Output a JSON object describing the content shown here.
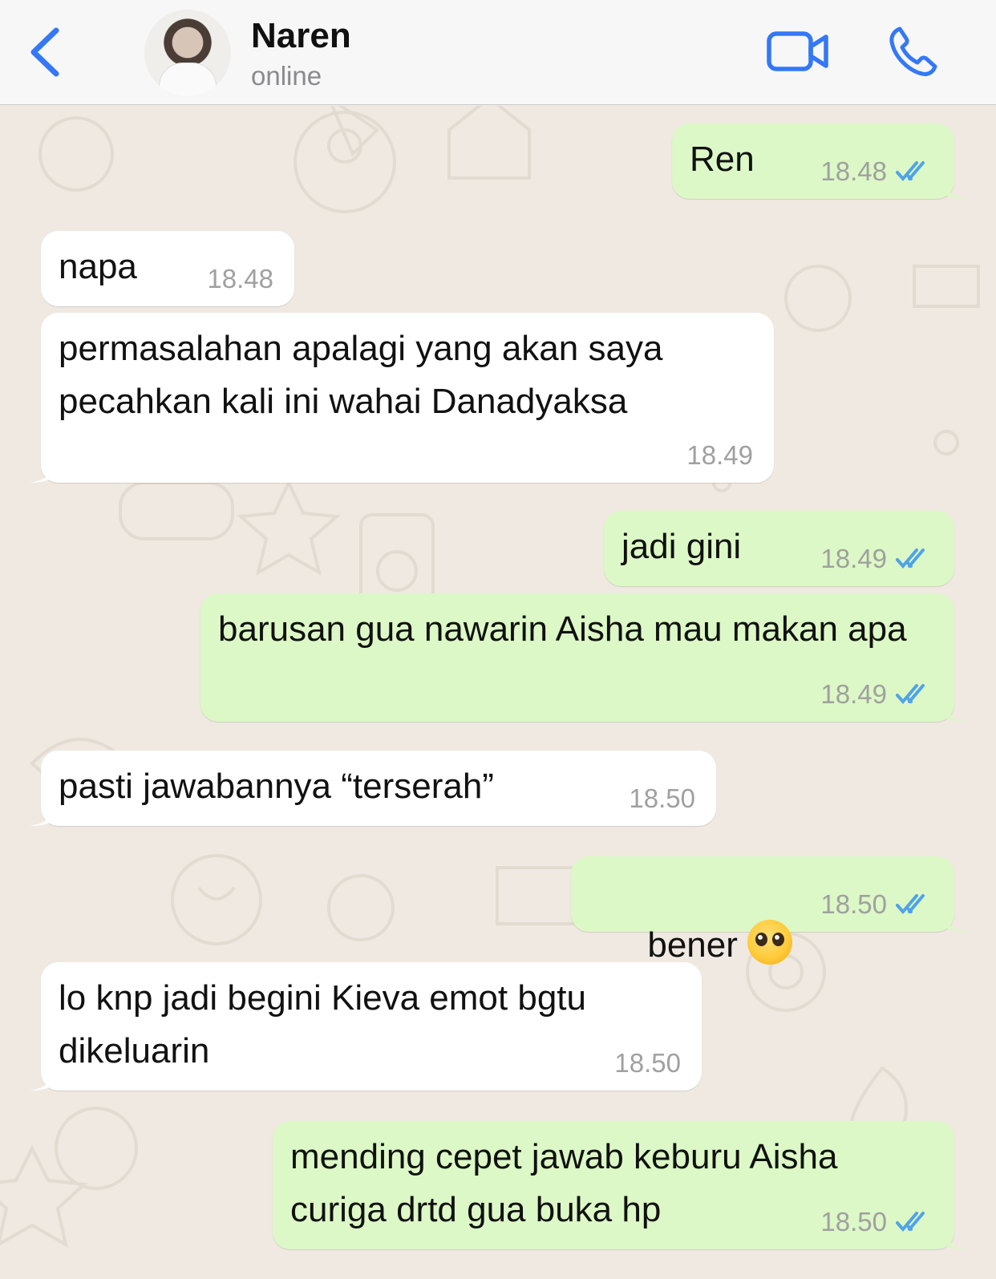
{
  "header": {
    "contact_name": "Naren",
    "contact_status": "online",
    "back_icon": "chevron-left-icon",
    "video_icon": "video-camera-icon",
    "call_icon": "phone-icon",
    "accent_color": "#3478f6"
  },
  "messages": [
    {
      "direction": "out",
      "text": "Ren",
      "time": "18.48",
      "status": "read"
    },
    {
      "direction": "in",
      "text": "napa",
      "time": "18.48"
    },
    {
      "direction": "in",
      "text": "permasalahan apalagi yang akan saya pecahkan kali ini wahai Danadyaksa",
      "time": "18.49"
    },
    {
      "direction": "out",
      "text": "jadi gini",
      "time": "18.49",
      "status": "read"
    },
    {
      "direction": "out",
      "text": "barusan gua nawarin Aisha mau makan apa",
      "time": "18.49",
      "status": "read"
    },
    {
      "direction": "in",
      "text": "pasti jawabannya “terserah”",
      "time": "18.50"
    },
    {
      "direction": "out",
      "text": "bener",
      "emoji": "pleading-face-emoji",
      "time": "18.50",
      "status": "read"
    },
    {
      "direction": "in",
      "text": "lo knp jadi begini Kieva emot bgtu dikeluarin",
      "time": "18.50"
    },
    {
      "direction": "out",
      "text": "mending cepet jawab keburu Aisha curiga drtd gua buka hp",
      "time": "18.50",
      "status": "read"
    }
  ],
  "colors": {
    "incoming_bubble": "#ffffff",
    "outgoing_bubble": "#dcf8c6",
    "read_tick": "#4fa3e8",
    "wallpaper": "#efe9e1"
  }
}
